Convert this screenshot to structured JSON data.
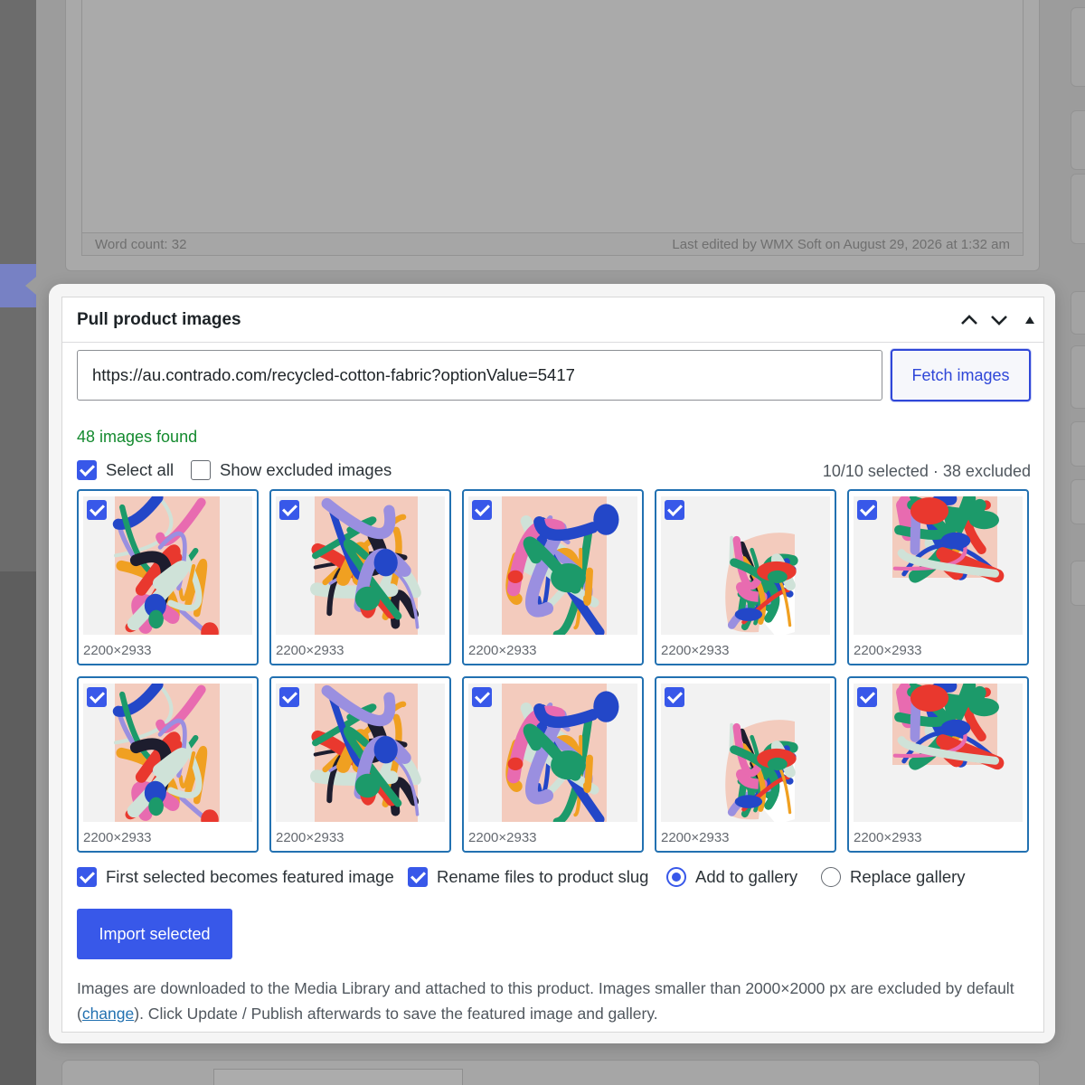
{
  "background": {
    "word_count": "Word count: 32",
    "last_edited": "Last edited by WMX Soft on August 29, 2026 at 1:32 am"
  },
  "metabox": {
    "title": "Pull product images",
    "controls": [
      "chevron-up-icon",
      "chevron-down-icon",
      "collapse-triangle-icon"
    ]
  },
  "fetch": {
    "url_value": "https://au.contrado.com/recycled-cotton-fabric?optionValue=5417",
    "button_label": "Fetch images"
  },
  "results": {
    "found_text": "48 images found",
    "select_all_label": "Select all",
    "select_all_checked": true,
    "show_excluded_label": "Show excluded images",
    "show_excluded_checked": false,
    "summary": "10/10 selected · 38 excluded"
  },
  "thumbnails": [
    {
      "dims": "2200×2933",
      "checked": true,
      "variant": "drape-front"
    },
    {
      "dims": "2200×2933",
      "checked": true,
      "variant": "drape-side"
    },
    {
      "dims": "2200×2933",
      "checked": true,
      "variant": "folded"
    },
    {
      "dims": "2200×2933",
      "checked": true,
      "variant": "table"
    },
    {
      "dims": "2200×2933",
      "checked": true,
      "variant": "swatch"
    },
    {
      "dims": "2200×2933",
      "checked": true,
      "variant": "drape-front"
    },
    {
      "dims": "2200×2933",
      "checked": true,
      "variant": "drape-side"
    },
    {
      "dims": "2200×2933",
      "checked": true,
      "variant": "folded"
    },
    {
      "dims": "2200×2933",
      "checked": true,
      "variant": "table"
    },
    {
      "dims": "2200×2933",
      "checked": true,
      "variant": "swatch"
    }
  ],
  "options": {
    "featured_label": "First selected becomes featured image",
    "featured_checked": true,
    "rename_label": "Rename files to product slug",
    "rename_checked": true,
    "add_gallery_label": "Add to gallery",
    "replace_gallery_label": "Replace gallery",
    "gallery_mode": "add"
  },
  "import_button_label": "Import selected",
  "help": {
    "before": "Images are downloaded to the Media Library and attached to this product. Images smaller than 2000×2000 px are excluded by default (",
    "link": "change",
    "after": "). Click Update / Publish afterwards to save the featured image and gallery."
  },
  "colors": {
    "accent": "#3858e9",
    "thumb_border": "#2271b1",
    "success": "#138a2e",
    "fabric_base": "#f3cbbd"
  }
}
